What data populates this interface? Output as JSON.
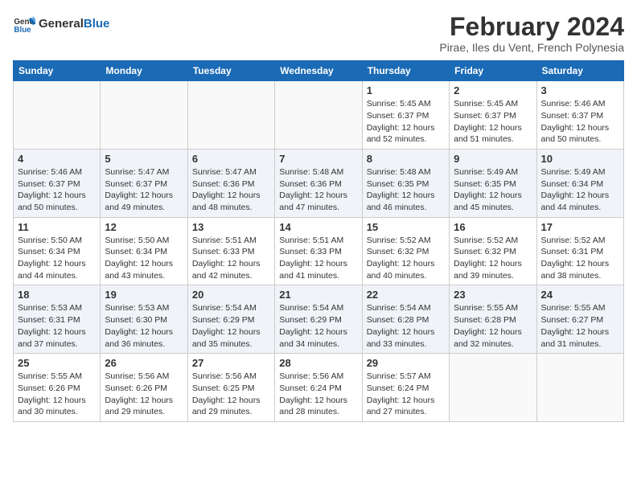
{
  "logo": {
    "text_general": "General",
    "text_blue": "Blue"
  },
  "title": "February 2024",
  "subtitle": "Pirae, Iles du Vent, French Polynesia",
  "days_of_week": [
    "Sunday",
    "Monday",
    "Tuesday",
    "Wednesday",
    "Thursday",
    "Friday",
    "Saturday"
  ],
  "weeks": [
    [
      {
        "day": "",
        "info": ""
      },
      {
        "day": "",
        "info": ""
      },
      {
        "day": "",
        "info": ""
      },
      {
        "day": "",
        "info": ""
      },
      {
        "day": "1",
        "info": "Sunrise: 5:45 AM\nSunset: 6:37 PM\nDaylight: 12 hours\nand 52 minutes."
      },
      {
        "day": "2",
        "info": "Sunrise: 5:45 AM\nSunset: 6:37 PM\nDaylight: 12 hours\nand 51 minutes."
      },
      {
        "day": "3",
        "info": "Sunrise: 5:46 AM\nSunset: 6:37 PM\nDaylight: 12 hours\nand 50 minutes."
      }
    ],
    [
      {
        "day": "4",
        "info": "Sunrise: 5:46 AM\nSunset: 6:37 PM\nDaylight: 12 hours\nand 50 minutes."
      },
      {
        "day": "5",
        "info": "Sunrise: 5:47 AM\nSunset: 6:37 PM\nDaylight: 12 hours\nand 49 minutes."
      },
      {
        "day": "6",
        "info": "Sunrise: 5:47 AM\nSunset: 6:36 PM\nDaylight: 12 hours\nand 48 minutes."
      },
      {
        "day": "7",
        "info": "Sunrise: 5:48 AM\nSunset: 6:36 PM\nDaylight: 12 hours\nand 47 minutes."
      },
      {
        "day": "8",
        "info": "Sunrise: 5:48 AM\nSunset: 6:35 PM\nDaylight: 12 hours\nand 46 minutes."
      },
      {
        "day": "9",
        "info": "Sunrise: 5:49 AM\nSunset: 6:35 PM\nDaylight: 12 hours\nand 45 minutes."
      },
      {
        "day": "10",
        "info": "Sunrise: 5:49 AM\nSunset: 6:34 PM\nDaylight: 12 hours\nand 44 minutes."
      }
    ],
    [
      {
        "day": "11",
        "info": "Sunrise: 5:50 AM\nSunset: 6:34 PM\nDaylight: 12 hours\nand 44 minutes."
      },
      {
        "day": "12",
        "info": "Sunrise: 5:50 AM\nSunset: 6:34 PM\nDaylight: 12 hours\nand 43 minutes."
      },
      {
        "day": "13",
        "info": "Sunrise: 5:51 AM\nSunset: 6:33 PM\nDaylight: 12 hours\nand 42 minutes."
      },
      {
        "day": "14",
        "info": "Sunrise: 5:51 AM\nSunset: 6:33 PM\nDaylight: 12 hours\nand 41 minutes."
      },
      {
        "day": "15",
        "info": "Sunrise: 5:52 AM\nSunset: 6:32 PM\nDaylight: 12 hours\nand 40 minutes."
      },
      {
        "day": "16",
        "info": "Sunrise: 5:52 AM\nSunset: 6:32 PM\nDaylight: 12 hours\nand 39 minutes."
      },
      {
        "day": "17",
        "info": "Sunrise: 5:52 AM\nSunset: 6:31 PM\nDaylight: 12 hours\nand 38 minutes."
      }
    ],
    [
      {
        "day": "18",
        "info": "Sunrise: 5:53 AM\nSunset: 6:31 PM\nDaylight: 12 hours\nand 37 minutes."
      },
      {
        "day": "19",
        "info": "Sunrise: 5:53 AM\nSunset: 6:30 PM\nDaylight: 12 hours\nand 36 minutes."
      },
      {
        "day": "20",
        "info": "Sunrise: 5:54 AM\nSunset: 6:29 PM\nDaylight: 12 hours\nand 35 minutes."
      },
      {
        "day": "21",
        "info": "Sunrise: 5:54 AM\nSunset: 6:29 PM\nDaylight: 12 hours\nand 34 minutes."
      },
      {
        "day": "22",
        "info": "Sunrise: 5:54 AM\nSunset: 6:28 PM\nDaylight: 12 hours\nand 33 minutes."
      },
      {
        "day": "23",
        "info": "Sunrise: 5:55 AM\nSunset: 6:28 PM\nDaylight: 12 hours\nand 32 minutes."
      },
      {
        "day": "24",
        "info": "Sunrise: 5:55 AM\nSunset: 6:27 PM\nDaylight: 12 hours\nand 31 minutes."
      }
    ],
    [
      {
        "day": "25",
        "info": "Sunrise: 5:55 AM\nSunset: 6:26 PM\nDaylight: 12 hours\nand 30 minutes."
      },
      {
        "day": "26",
        "info": "Sunrise: 5:56 AM\nSunset: 6:26 PM\nDaylight: 12 hours\nand 29 minutes."
      },
      {
        "day": "27",
        "info": "Sunrise: 5:56 AM\nSunset: 6:25 PM\nDaylight: 12 hours\nand 29 minutes."
      },
      {
        "day": "28",
        "info": "Sunrise: 5:56 AM\nSunset: 6:24 PM\nDaylight: 12 hours\nand 28 minutes."
      },
      {
        "day": "29",
        "info": "Sunrise: 5:57 AM\nSunset: 6:24 PM\nDaylight: 12 hours\nand 27 minutes."
      },
      {
        "day": "",
        "info": ""
      },
      {
        "day": "",
        "info": ""
      }
    ]
  ]
}
